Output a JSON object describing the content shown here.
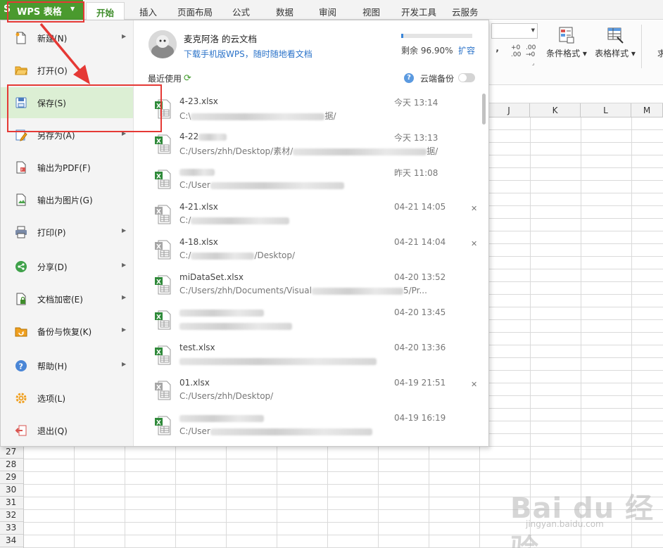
{
  "app": {
    "logo": "S",
    "name": "WPS 表格"
  },
  "tabs": [
    "开始",
    "插入",
    "页面布局",
    "公式",
    "数据",
    "审阅",
    "视图",
    "开发工具",
    "云服务"
  ],
  "toolbar": {
    "comma_glyph": "‚",
    "inc_decimal": "+0\n.00",
    "dec_decimal": ".00\n→0",
    "conditional_format": "条件格式",
    "table_style": "表格样式",
    "cut_label": "求"
  },
  "columns": [
    "J",
    "K",
    "L",
    "M"
  ],
  "rows": [
    "27",
    "28",
    "29",
    "30",
    "31",
    "32",
    "33",
    "34"
  ],
  "menu": {
    "items": [
      {
        "label": "新建(N)",
        "arrow": true,
        "icon": "new-doc-icon"
      },
      {
        "label": "打开(O)",
        "arrow": false,
        "icon": "folder-open-icon"
      },
      {
        "label": "保存(S)",
        "arrow": false,
        "icon": "save-icon",
        "selected": true
      },
      {
        "label": "另存为(A)",
        "arrow": true,
        "icon": "save-as-icon"
      },
      {
        "label": "输出为PDF(F)",
        "arrow": false,
        "icon": "pdf-icon"
      },
      {
        "label": "输出为图片(G)",
        "arrow": false,
        "icon": "image-export-icon"
      },
      {
        "label": "打印(P)",
        "arrow": true,
        "icon": "printer-icon"
      },
      {
        "label": "分享(D)",
        "arrow": true,
        "icon": "share-icon"
      },
      {
        "label": "文档加密(E)",
        "arrow": true,
        "icon": "lock-doc-icon"
      },
      {
        "label": "备份与恢复(K)",
        "arrow": true,
        "icon": "backup-icon"
      },
      {
        "label": "帮助(H)",
        "arrow": true,
        "icon": "help-icon"
      },
      {
        "label": "选项(L)",
        "arrow": false,
        "icon": "gear-icon"
      },
      {
        "label": "退出(Q)",
        "arrow": false,
        "icon": "exit-icon"
      }
    ]
  },
  "cloud": {
    "user": "麦克阿洛 的云文档",
    "download_link": "下载手机版WPS，随时随地看文档",
    "quota_used_fraction": 0.031,
    "quota_text": "剩余 96.90%",
    "expand": "扩容"
  },
  "recent": {
    "label": "最近使用",
    "help": "?",
    "backup_label": "云端备份",
    "backup_on": false,
    "files": [
      {
        "name": "4-23.xlsx",
        "path": "C:\\",
        "path_tail": "据/",
        "time": "今天 13:14",
        "type": "excel",
        "closable": false
      },
      {
        "name": "4-22",
        "name_tail": "",
        "path": "C:/Users/zhh/Desktop/素材/",
        "path_tail": "据/",
        "time": "今天 13:13",
        "type": "excel",
        "closable": false
      },
      {
        "name": "",
        "path": "C:/User",
        "path_tail": "",
        "time": "昨天 11:08",
        "type": "excel",
        "closable": false
      },
      {
        "name": "4-21.xlsx",
        "path": "C:/",
        "path_tail": "",
        "time": "04-21 14:05",
        "type": "gray",
        "closable": true
      },
      {
        "name": "4-18.xlsx",
        "path": "C:/",
        "path_tail": "/Desktop/",
        "time": "04-21 14:04",
        "type": "gray",
        "closable": true
      },
      {
        "name": "",
        "name_tail": "miDataSet.xlsx",
        "path": "C:/Users/zhh/Documents/Visual",
        "path_tail": "5/Pr...",
        "time": "04-20 13:52",
        "type": "excel",
        "closable": false
      },
      {
        "name": "",
        "path": "",
        "path_tail": "",
        "time": "04-20 13:45",
        "type": "excel",
        "closable": false
      },
      {
        "name": "test.xlsx",
        "path": "",
        "path_tail": "",
        "time": "04-20 13:36",
        "type": "excel",
        "closable": false
      },
      {
        "name": "01.xlsx",
        "path": "C:/Users/zhh/Desktop/",
        "path_tail": "",
        "time": "04-19 21:51",
        "type": "gray",
        "closable": true
      },
      {
        "name": "",
        "path": "C:/User",
        "path_tail": "",
        "time": "04-19 16:19",
        "type": "excel",
        "closable": false
      }
    ]
  },
  "watermark": {
    "title": "Bai du 经验",
    "subtitle": "jingyan.baidu.com"
  },
  "colors": {
    "brand_green": "#4a9a2e",
    "annotation_red": "#e53935",
    "selected_bg": "#dcefd4",
    "link_blue": "#2b73c9"
  }
}
